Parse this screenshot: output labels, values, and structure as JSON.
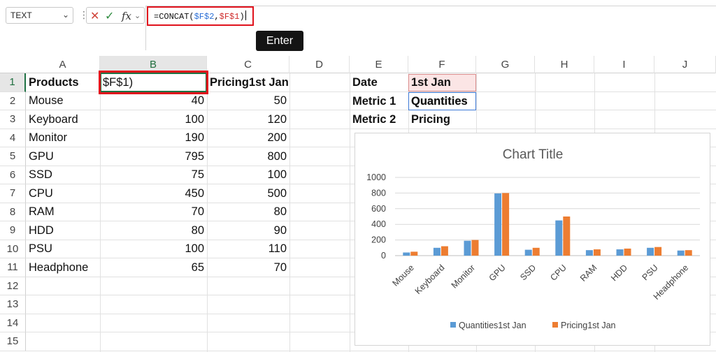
{
  "formula_bar": {
    "name_box": "TEXT",
    "fx_label": "fx",
    "formula_prefix": "=CONCAT(",
    "formula_ref1": "$F$2",
    "formula_comma": ",",
    "formula_ref2": "$F$1",
    "formula_suffix": ")",
    "tooltip": "Enter"
  },
  "columns": [
    "A",
    "B",
    "C",
    "D",
    "E",
    "F",
    "G",
    "H",
    "I",
    "J"
  ],
  "rows": [
    "1",
    "2",
    "3",
    "4",
    "5",
    "6",
    "7",
    "8",
    "9",
    "10",
    "11",
    "12",
    "13",
    "14",
    "15"
  ],
  "sheet": {
    "a1": "Products",
    "b1": "$F$1)",
    "c1": "Pricing1st Jan",
    "products": [
      "Mouse",
      "Keyboard",
      "Monitor",
      "GPU",
      "SSD",
      "CPU",
      "RAM",
      "HDD",
      "PSU",
      "Headphone"
    ],
    "quantities": [
      "40",
      "100",
      "190",
      "795",
      "75",
      "450",
      "70",
      "80",
      "100",
      "65"
    ],
    "pricing": [
      "50",
      "120",
      "200",
      "800",
      "100",
      "500",
      "80",
      "90",
      "110",
      "70"
    ],
    "e1": "Date",
    "f1": "1st Jan",
    "e2": "Metric 1",
    "f2": "Quantities",
    "e3": "Metric 2",
    "f3": "Pricing"
  },
  "colors": {
    "series1": "#5b9bd5",
    "series2": "#ed7d31",
    "selection": "#e0121c",
    "excel_green": "#1f7244"
  },
  "chart_data": {
    "type": "bar",
    "title": "Chart Title",
    "categories": [
      "Mouse",
      "Keyboard",
      "Monitor",
      "GPU",
      "SSD",
      "CPU",
      "RAM",
      "HDD",
      "PSU",
      "Headphone"
    ],
    "series": [
      {
        "name": "Quantities1st Jan",
        "values": [
          40,
          100,
          190,
          795,
          75,
          450,
          70,
          80,
          100,
          65
        ]
      },
      {
        "name": "Pricing1st Jan",
        "values": [
          50,
          120,
          200,
          800,
          100,
          500,
          80,
          90,
          110,
          70
        ]
      }
    ],
    "yticks": [
      "0",
      "200",
      "400",
      "600",
      "800",
      "1000"
    ],
    "ylim": [
      0,
      1000
    ],
    "grid": true,
    "legend": "bottom"
  }
}
